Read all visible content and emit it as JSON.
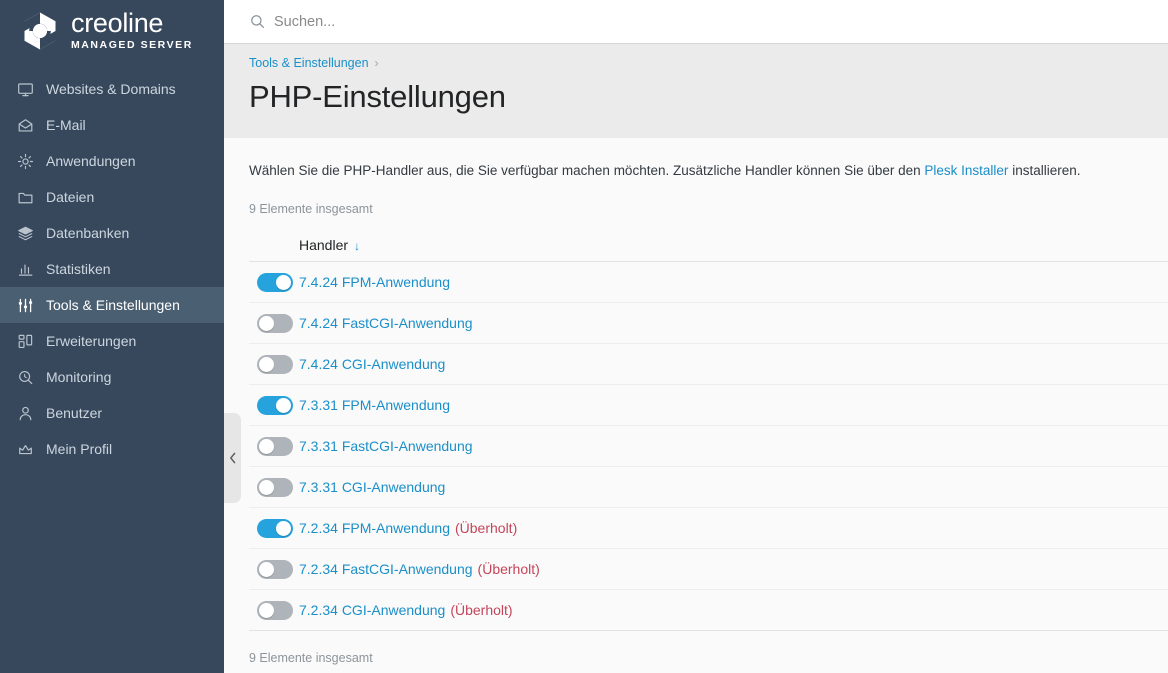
{
  "brand": {
    "name": "creoline",
    "subtitle": "MANAGED SERVER",
    "logo_icon": "creoline-hex-logo"
  },
  "sidebar": {
    "items": [
      {
        "label": "Websites & Domains",
        "icon": "monitor-icon",
        "active": false
      },
      {
        "label": "E-Mail",
        "icon": "envelope-icon",
        "active": false
      },
      {
        "label": "Anwendungen",
        "icon": "gear-icon",
        "active": false
      },
      {
        "label": "Dateien",
        "icon": "folder-icon",
        "active": false
      },
      {
        "label": "Datenbanken",
        "icon": "database-stack-icon",
        "active": false
      },
      {
        "label": "Statistiken",
        "icon": "bar-chart-icon",
        "active": false
      },
      {
        "label": "Tools & Einstellungen",
        "icon": "sliders-icon",
        "active": true
      },
      {
        "label": "Erweiterungen",
        "icon": "blocks-icon",
        "active": false
      },
      {
        "label": "Monitoring",
        "icon": "magnifier-clock-icon",
        "active": false
      },
      {
        "label": "Benutzer",
        "icon": "user-icon",
        "active": false
      },
      {
        "label": "Mein Profil",
        "icon": "crown-icon",
        "active": false
      }
    ],
    "collapse_handle_icon": "chevron-left-icon"
  },
  "search": {
    "placeholder": "Suchen...",
    "value": "",
    "icon": "search-icon"
  },
  "header": {
    "breadcrumb": [
      {
        "label": "Tools & Einstellungen",
        "link": true
      }
    ],
    "breadcrumb_separator": "›",
    "title": "PHP-Einstellungen"
  },
  "main": {
    "intro_before": "Wählen Sie die PHP-Handler aus, die Sie verfügbar machen möchten. Zusätzliche Handler können Sie über den ",
    "intro_link": "Plesk Installer",
    "intro_after": " installieren.",
    "count_top": "9 Elemente insgesamt",
    "count_bottom": "9 Elemente insgesamt",
    "table": {
      "column_header": "Handler",
      "sort_icon": "↓",
      "rows": [
        {
          "enabled": true,
          "name": "7.4.24 FPM-Anwendung",
          "obsolete": ""
        },
        {
          "enabled": false,
          "name": "7.4.24 FastCGI-Anwendung",
          "obsolete": ""
        },
        {
          "enabled": false,
          "name": "7.4.24 CGI-Anwendung",
          "obsolete": ""
        },
        {
          "enabled": true,
          "name": "7.3.31 FPM-Anwendung",
          "obsolete": ""
        },
        {
          "enabled": false,
          "name": "7.3.31 FastCGI-Anwendung",
          "obsolete": ""
        },
        {
          "enabled": false,
          "name": "7.3.31 CGI-Anwendung",
          "obsolete": ""
        },
        {
          "enabled": true,
          "name": "7.2.34 FPM-Anwendung",
          "obsolete": "(Überholt)"
        },
        {
          "enabled": false,
          "name": "7.2.34 FastCGI-Anwendung",
          "obsolete": "(Überholt)"
        },
        {
          "enabled": false,
          "name": "7.2.34 CGI-Anwendung",
          "obsolete": "(Überholt)"
        }
      ]
    }
  },
  "colors": {
    "sidebar_bg": "#37485c",
    "sidebar_active_bg": "#4b5f73",
    "link_blue": "#1a8fc9",
    "toggle_on": "#26a3dd",
    "toggle_off": "#aeb4b9",
    "obsolete_red": "#c4455a",
    "header_band": "#ebebeb",
    "content_bg": "#fafafa"
  }
}
